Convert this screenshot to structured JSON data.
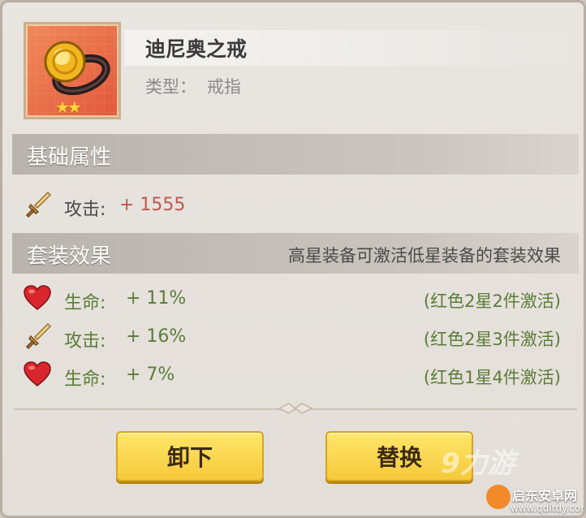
{
  "item": {
    "name": "迪尼奥之戒",
    "type_label": "类型：",
    "type_value": "戒指",
    "stars": 2
  },
  "base": {
    "title": "基础属性",
    "stat_label": "攻击:",
    "stat_value": "+ 1555"
  },
  "set": {
    "title": "套装效果",
    "note": "高星装备可激活低星装备的套装效果",
    "rows": [
      {
        "icon": "heart-icon",
        "label": "生命:",
        "value": "+ 11%",
        "cond": "(红色2星2件激活)"
      },
      {
        "icon": "sword-icon",
        "label": "攻击:",
        "value": "+ 16%",
        "cond": "(红色2星3件激活)"
      },
      {
        "icon": "heart-icon",
        "label": "生命:",
        "value": "+ 7%",
        "cond": "(红色1星4件激活)"
      }
    ]
  },
  "buttons": {
    "unequip": "卸下",
    "replace": "替换"
  },
  "watermark": {
    "logo": "9力游",
    "site": "启东安卓网",
    "url": "www.qdltdy.com"
  },
  "colors": {
    "accent_button": "#f5c93a",
    "set_text": "#5a7d38",
    "base_value": "#c0574c"
  }
}
